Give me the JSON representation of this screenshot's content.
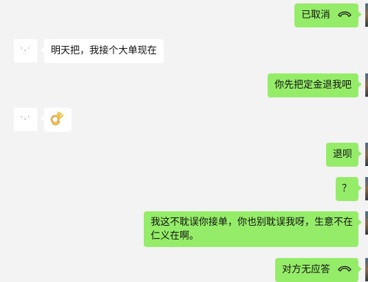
{
  "chat": {
    "messages": [
      {
        "side": "me",
        "kind": "call",
        "text": "已取消",
        "icon": "phone-hangup-icon"
      },
      {
        "side": "them",
        "kind": "text",
        "text": "明天把，我接个大单现在",
        "avatar_text": "˙·˙"
      },
      {
        "side": "me",
        "kind": "text",
        "text": "你先把定金退我吧"
      },
      {
        "side": "them",
        "kind": "emoji",
        "icon": "ok-hand-emoji-icon",
        "avatar_text": "˙·˙"
      },
      {
        "side": "me",
        "kind": "text",
        "text": "退呗"
      },
      {
        "side": "me",
        "kind": "text",
        "text": "？"
      },
      {
        "side": "me",
        "kind": "text",
        "line1": "我这不耽误你接单，你也别耽误我呀，生意不在",
        "line2": "仁义在啊。"
      },
      {
        "side": "me",
        "kind": "call",
        "text": "对方无应答",
        "icon": "phone-hangup-icon"
      }
    ]
  }
}
